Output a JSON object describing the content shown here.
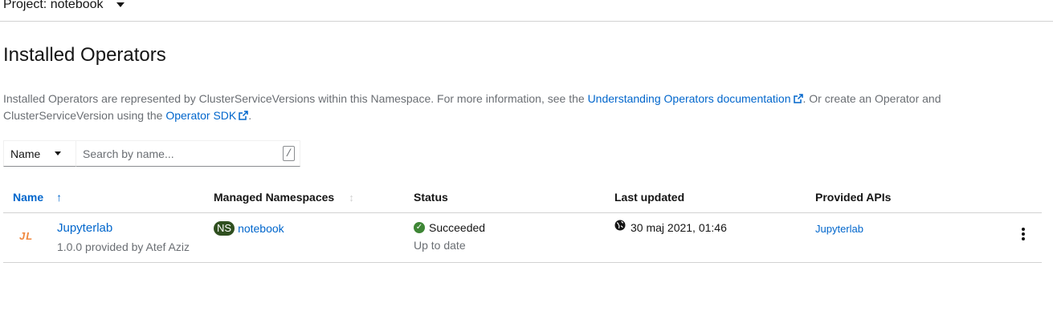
{
  "project": {
    "label": "Project: notebook"
  },
  "page": {
    "title": "Installed Operators",
    "description_1": "Installed Operators are represented by ClusterServiceVersions within this Namespace. For more information, see the ",
    "link_docs": "Understanding Operators documentation",
    "description_2": ". Or create an Operator and ClusterServiceVersion using the ",
    "link_sdk": "Operator SDK",
    "description_3": "."
  },
  "filter": {
    "type_label": "Name",
    "search_placeholder": "Search by name...",
    "shortcut": "/"
  },
  "table": {
    "headers": {
      "name": "Name",
      "managed_namespaces": "Managed Namespaces",
      "status": "Status",
      "last_updated": "Last updated",
      "provided_apis": "Provided APIs"
    },
    "rows": [
      {
        "logo_text": "JL",
        "name": "Jupyterlab",
        "provider": "1.0.0 provided by Atef Aziz",
        "ns_badge": "NS",
        "namespace": "notebook",
        "status": "Succeeded",
        "status_sub": "Up to date",
        "last_updated": "30 maj 2021, 01:46",
        "provided_api": "Jupyterlab"
      }
    ]
  },
  "colors": {
    "link": "#0066cc",
    "success": "#3e8635",
    "ns_badge": "#2f4f1f",
    "logo": "#f0883e"
  },
  "icons": {
    "project_dropdown": "caret-down-icon",
    "external_link": "external-link-icon",
    "sort_asc": "arrow-up-icon",
    "sort_both": "sort-icon",
    "status": "check-circle-icon",
    "timestamp": "globe-icon",
    "actions": "kebab-icon"
  }
}
